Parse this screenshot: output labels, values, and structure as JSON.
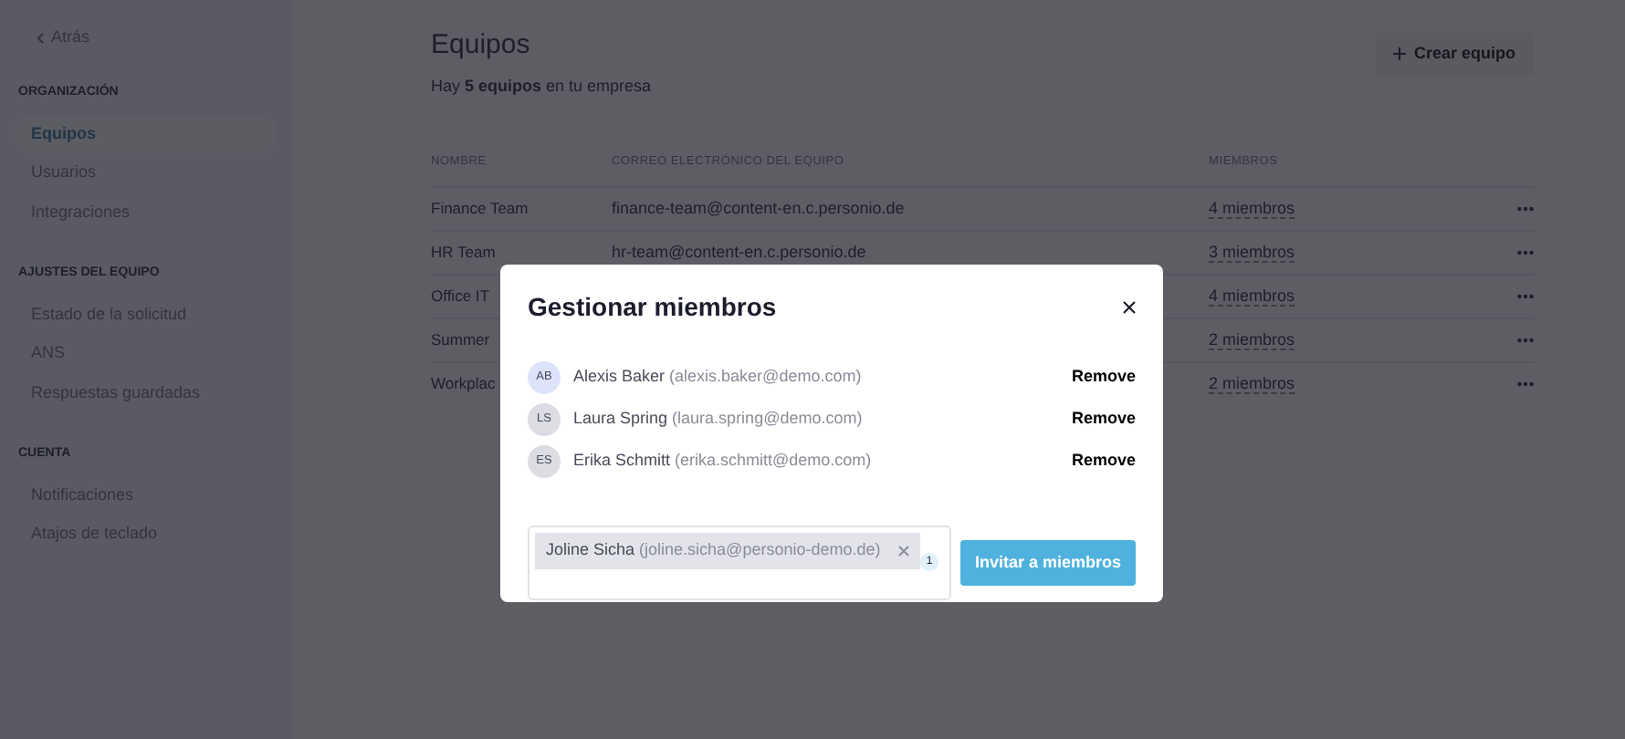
{
  "sidebar": {
    "back": "Atrás",
    "sections": [
      {
        "title": "ORGANIZACIÓN",
        "items": [
          {
            "label": "Equipos",
            "selected": true
          },
          {
            "label": "Usuarios",
            "selected": false
          },
          {
            "label": "Integraciones",
            "selected": false
          }
        ]
      },
      {
        "title": "AJUSTES DEL EQUIPO",
        "items": [
          {
            "label": "Estado de la solicitud",
            "selected": false
          },
          {
            "label": "ANS",
            "selected": false
          },
          {
            "label": "Respuestas guardadas",
            "selected": false
          }
        ]
      },
      {
        "title": "CUENTA",
        "items": [
          {
            "label": "Notificaciones",
            "selected": false
          },
          {
            "label": "Atajos de teclado",
            "selected": false
          }
        ]
      }
    ]
  },
  "page": {
    "title": "Equipos",
    "subtitle": "Hay **5 equipos** en tu empresa",
    "create_button": "Crear equipo"
  },
  "table": {
    "columns": [
      "NOMBRE",
      "CORREO ELECTRÓNICO DEL EQUIPO",
      "MIEMBROS"
    ],
    "rows": [
      {
        "name": "Finance Team",
        "email": "finance-team@content-en.c.personio.de",
        "members": "4 miembros"
      },
      {
        "name": "HR Team",
        "email": "hr-team@content-en.c.personio.de",
        "members": "3 miembros"
      },
      {
        "name": "Office IT",
        "members": "4 miembros"
      },
      {
        "name": "Summer",
        "members": "2 miembros"
      },
      {
        "name": "Workplac",
        "members": "2 miembros"
      }
    ]
  },
  "modal": {
    "title": "Gestionar miembros",
    "members": [
      {
        "initials": "AB",
        "color": "#dde3fb",
        "name": "Alexis Baker",
        "email": "(alexis.baker@demo.com)",
        "action": "Remove"
      },
      {
        "initials": "LS",
        "color": "#dcdde3",
        "name": "Laura Spring",
        "email": "(laura.spring@demo.com)",
        "action": "Remove"
      },
      {
        "initials": "ES",
        "color": "#dcdde3",
        "name": "Erika Schmitt",
        "email": "(erika.schmitt@demo.com)",
        "action": "Remove"
      }
    ],
    "invite": {
      "chips": [
        {
          "name": "Joline Sicha",
          "email": "(joline.sicha@personio-demo.de)"
        }
      ],
      "count": "1",
      "button": "Invitar a miembros"
    }
  }
}
